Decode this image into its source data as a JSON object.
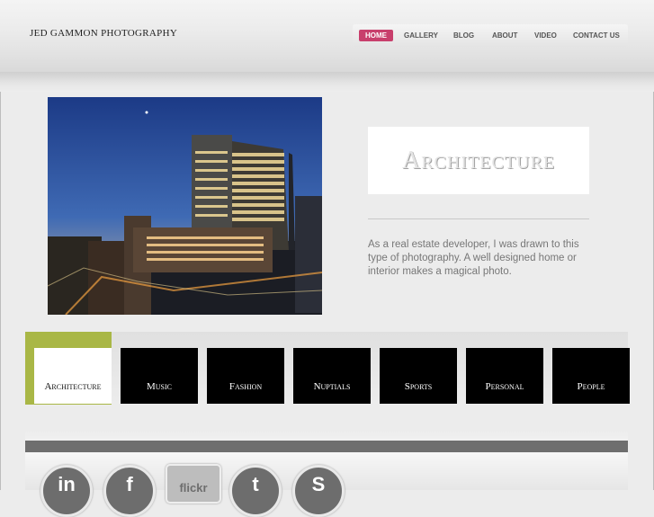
{
  "site": {
    "logo": "JED GAMMON PHOTOGRAPHY"
  },
  "nav": {
    "items": [
      {
        "label": "HOME",
        "active": true
      },
      {
        "label": "GALLERY"
      },
      {
        "label": "BLOG"
      },
      {
        "label": "ABOUT"
      },
      {
        "label": "VIDEO"
      },
      {
        "label": "CONTACT US"
      }
    ]
  },
  "hero": {
    "title": "Architecture",
    "description": "As a real estate developer, I was drawn to this type of photography. A well designed home or interior makes a magical photo."
  },
  "categories": [
    {
      "label": "Architecture",
      "active": true
    },
    {
      "label": "Music"
    },
    {
      "label": "Fashion"
    },
    {
      "label": "Nuptials"
    },
    {
      "label": "Sports"
    },
    {
      "label": "Personal"
    },
    {
      "label": "People"
    }
  ],
  "social": {
    "linkedin": "in",
    "facebook": "f",
    "flickr": "flickr",
    "twitter": "t",
    "other": "S"
  },
  "colors": {
    "nav_active": "#c83f6c",
    "accent_green": "#a9b746",
    "footer_bar": "#6e6e6e"
  }
}
